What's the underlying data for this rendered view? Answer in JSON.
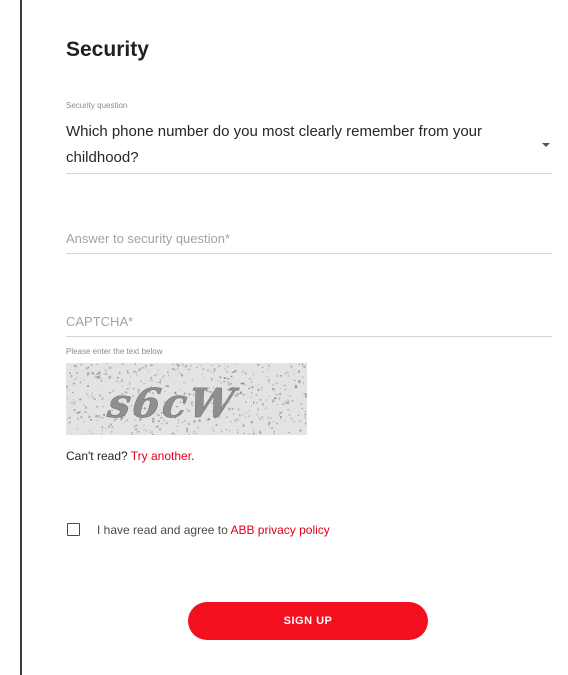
{
  "security": {
    "title": "Security",
    "question_label": "Security question",
    "question_value": "Which phone number do you most clearly remember from your childhood?",
    "answer_placeholder": "Answer to security question*",
    "captcha_placeholder": "CAPTCHA*",
    "captcha_hint": "Please enter the text below",
    "captcha_text": "s6cW",
    "cant_read": "Can't read?",
    "try_another": "Try another",
    "try_another_suffix": ".",
    "agree_text": "I have read and agree to",
    "privacy_link": "ABB privacy policy",
    "agreed": false,
    "signup_label": "SIGN UP"
  },
  "colors": {
    "accent": "#f2101e",
    "link": "#e0001b"
  }
}
